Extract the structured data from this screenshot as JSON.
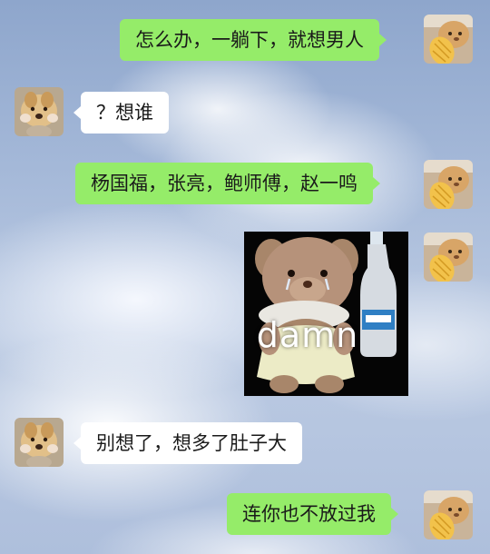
{
  "messages": [
    {
      "side": "right",
      "type": "text",
      "text": "怎么办，一躺下，就想男人"
    },
    {
      "side": "left",
      "type": "text",
      "text": "？想谁"
    },
    {
      "side": "right",
      "type": "text",
      "text": "杨国福，张亮，鲍师傅，赵一鸣"
    },
    {
      "side": "right",
      "type": "sticker",
      "caption": "damn"
    },
    {
      "side": "left",
      "type": "text",
      "text": "别想了，想多了肚子大"
    },
    {
      "side": "right",
      "type": "text",
      "text": "连你也不放过我"
    }
  ],
  "colors": {
    "sent_bubble": "#95ec69",
    "received_bubble": "#ffffff"
  }
}
